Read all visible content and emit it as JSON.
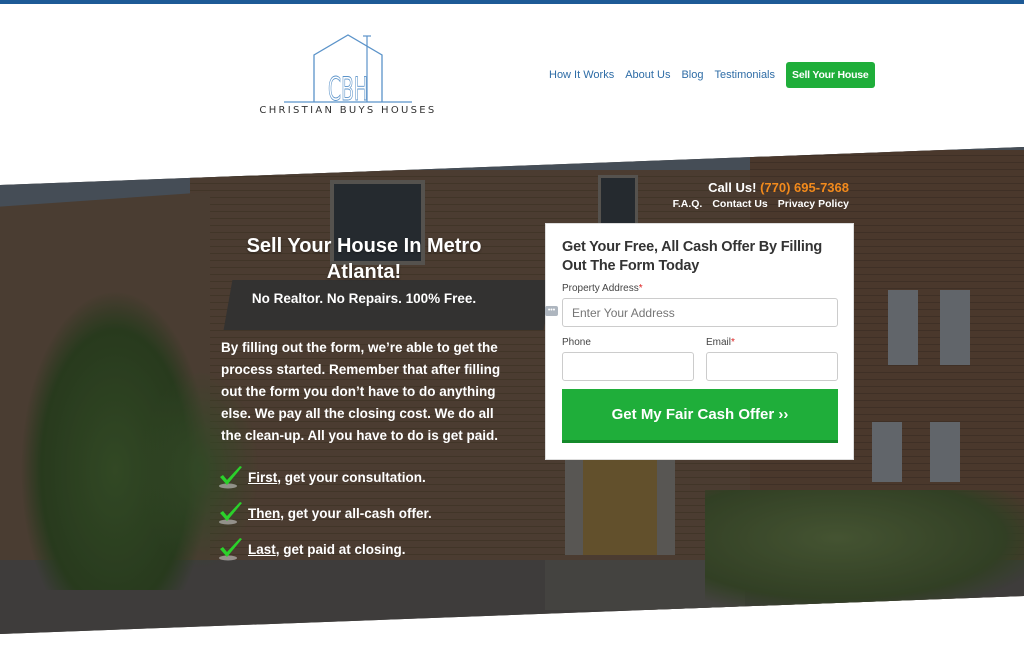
{
  "colors": {
    "brand_blue": "#1d5a96",
    "nav_link": "#2e6ca6",
    "cta_green": "#1fae3a",
    "phone_orange": "#f28a1c",
    "required_red": "#dd2222"
  },
  "header": {
    "logo_monogram": "CBH",
    "logo_text": "CHRISTIAN BUYS HOUSES",
    "nav": [
      {
        "label": "How It Works"
      },
      {
        "label": "About Us"
      },
      {
        "label": "Blog"
      },
      {
        "label": "Testimonials"
      }
    ],
    "cta_label": "Sell Your House"
  },
  "hero": {
    "call_label": "Call Us!",
    "phone": "(770) 695-7368",
    "top_links": [
      {
        "label": "F.A.Q."
      },
      {
        "label": "Contact Us"
      },
      {
        "label": "Privacy Policy"
      }
    ],
    "title": "Sell Your House In Metro Atlanta!",
    "subtitle": "No Realtor. No Repairs. 100% Free.",
    "body": "By filling out the form, we’re able to get the process started. Remember that after filling out the form you don’t have to do anything else. We pay all the closing cost. We do all the clean-up. All you have to do is get paid.",
    "steps": [
      {
        "keyword": "First",
        "rest": ", get your consultation.",
        "icon": "checkmark-icon"
      },
      {
        "keyword": "Then",
        "rest": ", get your all-cash offer.",
        "icon": "checkmark-icon"
      },
      {
        "keyword": "Last",
        "rest": ", get paid at closing.",
        "icon": "checkmark-icon"
      }
    ]
  },
  "form": {
    "title": "Get Your Free, All Cash Offer By Filling Out The Form Today",
    "address_label": "Property Address",
    "address_placeholder": "Enter Your Address",
    "address_value": "",
    "phone_label": "Phone",
    "phone_value": "",
    "email_label": "Email",
    "email_value": "",
    "required_mark": "*",
    "submit_label": "Get My Fair Cash Offer ››"
  }
}
